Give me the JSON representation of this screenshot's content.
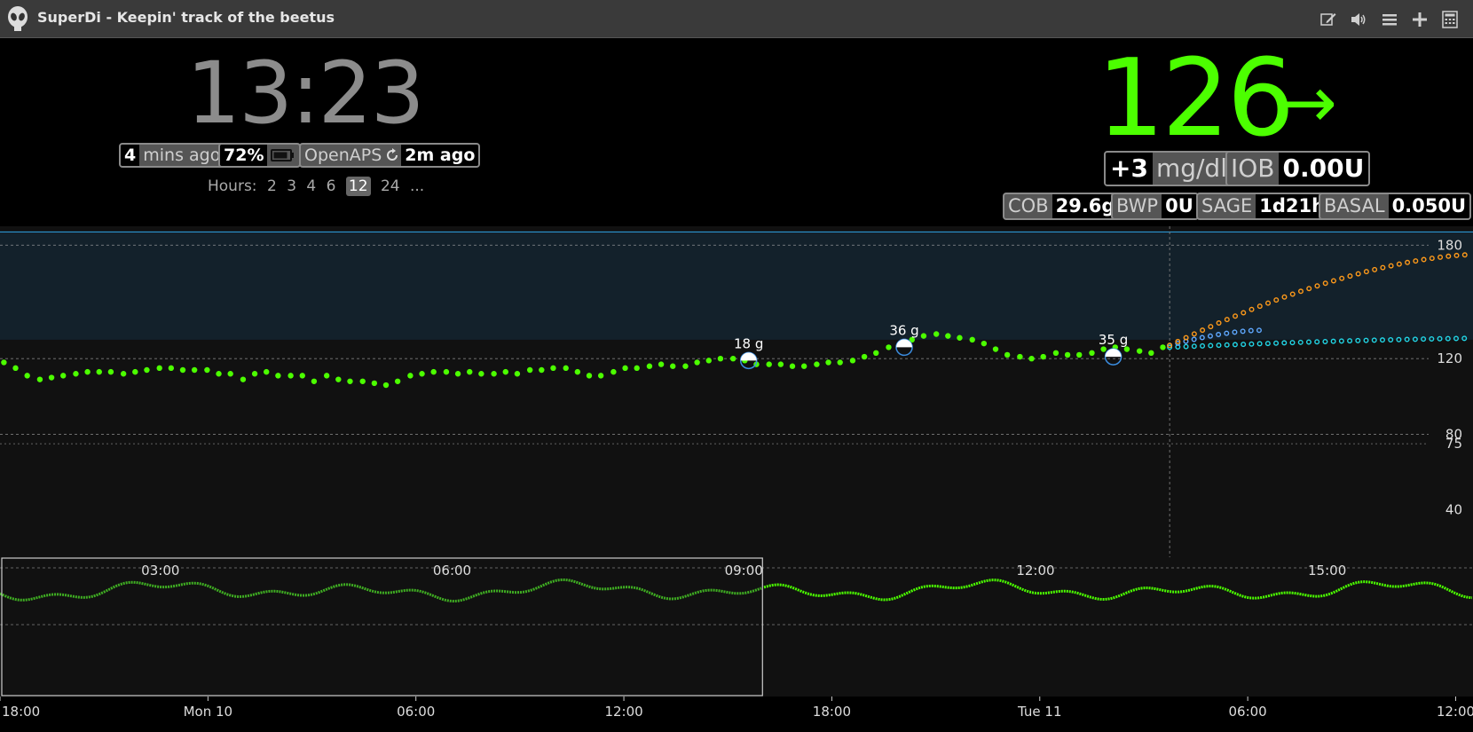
{
  "titlebar": {
    "title": "SuperDi - Keepin' track of the beetus",
    "icons": [
      "edit-icon",
      "speaker-icon",
      "menu-icon",
      "plus-icon",
      "calculator-icon"
    ]
  },
  "clock": "13:23",
  "status": {
    "last_reading_num": "4",
    "last_reading_text": "mins ago",
    "battery": "72%",
    "openaps_label": "OpenAPS",
    "openaps_age": "2m ago"
  },
  "hours": {
    "label": "Hours:",
    "options": [
      "2",
      "3",
      "4",
      "6",
      "12",
      "24",
      "..."
    ],
    "selected": "12"
  },
  "bg": {
    "value": "126",
    "arrow": "→",
    "delta": "+3",
    "units": "mg/dl",
    "iob_label": "IOB",
    "iob_value": "0.00U",
    "cob_label": "COB",
    "cob_value": "29.6g",
    "bwp_label": "BWP",
    "bwp_value": "0U",
    "sage_label": "SAGE",
    "sage_value": "1d21h",
    "basal_label": "BASAL",
    "basal_value": "0.050U"
  },
  "colors": {
    "bg_green": "#4cff00",
    "target_band": "#13212b",
    "high_line": "#2fa4e7",
    "forecast_orange": "#ff9a1a",
    "forecast_cyan": "#22d6e6",
    "forecast_blue": "#5fa8ff"
  },
  "chart_data": [
    {
      "type": "scatter",
      "name": "main",
      "x_labels": [
        "03:00",
        "06:00",
        "09:00",
        "12:00",
        "15:00"
      ],
      "x_range_hours": [
        1.35,
        16.5
      ],
      "now_hour": 13.38,
      "y_ticks": [
        180,
        120,
        80,
        75,
        40
      ],
      "ylim": [
        15,
        190
      ],
      "target_range": [
        130,
        180
      ],
      "bg_points": [
        [
          1.39,
          118
        ],
        [
          1.51,
          115
        ],
        [
          1.63,
          111
        ],
        [
          1.76,
          109
        ],
        [
          1.88,
          110
        ],
        [
          2.0,
          111
        ],
        [
          2.13,
          112
        ],
        [
          2.25,
          113
        ],
        [
          2.37,
          113
        ],
        [
          2.49,
          113
        ],
        [
          2.62,
          112
        ],
        [
          2.74,
          113
        ],
        [
          2.86,
          114
        ],
        [
          2.99,
          115
        ],
        [
          3.11,
          115
        ],
        [
          3.23,
          114
        ],
        [
          3.35,
          114
        ],
        [
          3.48,
          114
        ],
        [
          3.6,
          112
        ],
        [
          3.72,
          112
        ],
        [
          3.85,
          109
        ],
        [
          3.97,
          112
        ],
        [
          4.09,
          113
        ],
        [
          4.21,
          111
        ],
        [
          4.34,
          111
        ],
        [
          4.46,
          111
        ],
        [
          4.58,
          108
        ],
        [
          4.71,
          111
        ],
        [
          4.83,
          109
        ],
        [
          4.95,
          108
        ],
        [
          5.08,
          108
        ],
        [
          5.2,
          107
        ],
        [
          5.32,
          106
        ],
        [
          5.44,
          108
        ],
        [
          5.57,
          111
        ],
        [
          5.69,
          112
        ],
        [
          5.81,
          113
        ],
        [
          5.94,
          113
        ],
        [
          6.06,
          112
        ],
        [
          6.18,
          113
        ],
        [
          6.3,
          112
        ],
        [
          6.43,
          112
        ],
        [
          6.55,
          113
        ],
        [
          6.67,
          112
        ],
        [
          6.8,
          114
        ],
        [
          6.92,
          114
        ],
        [
          7.04,
          115
        ],
        [
          7.17,
          115
        ],
        [
          7.29,
          113
        ],
        [
          7.41,
          111
        ],
        [
          7.53,
          111
        ],
        [
          7.66,
          113
        ],
        [
          7.78,
          115
        ],
        [
          7.9,
          115
        ],
        [
          8.03,
          116
        ],
        [
          8.15,
          117
        ],
        [
          8.27,
          116
        ],
        [
          8.4,
          116
        ],
        [
          8.52,
          118
        ],
        [
          8.64,
          119
        ],
        [
          8.76,
          120
        ],
        [
          8.89,
          120
        ],
        [
          9.01,
          119
        ],
        [
          9.13,
          117
        ],
        [
          9.26,
          117
        ],
        [
          9.38,
          117
        ],
        [
          9.5,
          116
        ],
        [
          9.62,
          116
        ],
        [
          9.75,
          117
        ],
        [
          9.87,
          118
        ],
        [
          9.99,
          118
        ],
        [
          10.12,
          119
        ],
        [
          10.24,
          121
        ],
        [
          10.36,
          123
        ],
        [
          10.49,
          126
        ],
        [
          10.61,
          128
        ],
        [
          10.73,
          130
        ],
        [
          10.85,
          132
        ],
        [
          10.98,
          133
        ],
        [
          11.1,
          132
        ],
        [
          11.22,
          131
        ],
        [
          11.35,
          130
        ],
        [
          11.47,
          128
        ],
        [
          11.59,
          125
        ],
        [
          11.71,
          122
        ],
        [
          11.84,
          121
        ],
        [
          11.96,
          120
        ],
        [
          12.08,
          121
        ],
        [
          12.21,
          123
        ],
        [
          12.33,
          122
        ],
        [
          12.45,
          122
        ],
        [
          12.58,
          123
        ],
        [
          12.7,
          125
        ],
        [
          12.82,
          126
        ],
        [
          12.94,
          125
        ],
        [
          13.07,
          124
        ],
        [
          13.19,
          123
        ],
        [
          13.31,
          126
        ]
      ],
      "carbs": [
        {
          "hour": 9.05,
          "label": "18 g",
          "value": 119
        },
        {
          "hour": 10.65,
          "label": "36 g",
          "value": 126
        },
        {
          "hour": 12.8,
          "label": "35 g",
          "value": 121
        }
      ],
      "forecast_orange": {
        "start": 13.38,
        "end": 16.5,
        "from": 127,
        "to": 175
      },
      "forecast_cyan": {
        "start": 13.38,
        "end": 17.0,
        "from": 126,
        "to": 131
      },
      "forecast_blue": {
        "start": 13.38,
        "end": 14.3,
        "from": 127,
        "to": 135
      }
    },
    {
      "type": "line",
      "name": "navigator",
      "x_labels": [
        "18:00",
        "Mon 10",
        "06:00",
        "12:00",
        "18:00",
        "Tue 11",
        "06:00",
        "12:00"
      ],
      "x_range_hours": [
        -6,
        36.5
      ],
      "brush_hours": [
        -6,
        16.0
      ]
    }
  ]
}
